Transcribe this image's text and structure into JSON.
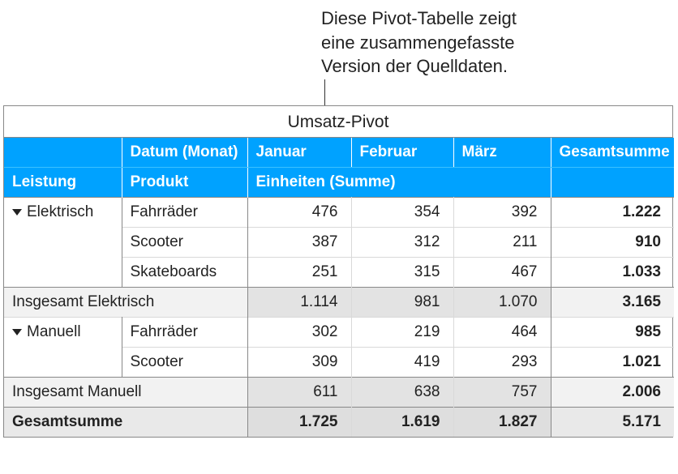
{
  "caption": {
    "line1": "Diese Pivot-Tabelle zeigt",
    "line2": "eine zusammengefasste",
    "line3": "Version der Quelldaten."
  },
  "table": {
    "title": "Umsatz-Pivot",
    "headers": {
      "date_label": "Datum (Monat)",
      "months": {
        "m1": "Januar",
        "m2": "Februar",
        "m3": "März"
      },
      "grand_total": "Gesamtsumme",
      "leistung": "Leistung",
      "produkt": "Produkt",
      "units_sum": "Einheiten (Summe)"
    },
    "groups": [
      {
        "name": "Elektrisch",
        "rows": [
          {
            "product": "Fahrräder",
            "m1": "476",
            "m2": "354",
            "m3": "392",
            "total": "1.222"
          },
          {
            "product": "Scooter",
            "m1": "387",
            "m2": "312",
            "m3": "211",
            "total": "910"
          },
          {
            "product": "Skateboards",
            "m1": "251",
            "m2": "315",
            "m3": "467",
            "total": "1.033"
          }
        ],
        "subtotal": {
          "label": "Insgesamt Elektrisch",
          "m1": "1.114",
          "m2": "981",
          "m3": "1.070",
          "total": "3.165"
        }
      },
      {
        "name": "Manuell",
        "rows": [
          {
            "product": "Fahrräder",
            "m1": "302",
            "m2": "219",
            "m3": "464",
            "total": "985"
          },
          {
            "product": "Scooter",
            "m1": "309",
            "m2": "419",
            "m3": "293",
            "total": "1.021"
          }
        ],
        "subtotal": {
          "label": "Insgesamt Manuell",
          "m1": "611",
          "m2": "638",
          "m3": "757",
          "total": "2.006"
        }
      }
    ],
    "grand": {
      "label": "Gesamtsumme",
      "m1": "1.725",
      "m2": "1.619",
      "m3": "1.827",
      "total": "5.171"
    }
  }
}
